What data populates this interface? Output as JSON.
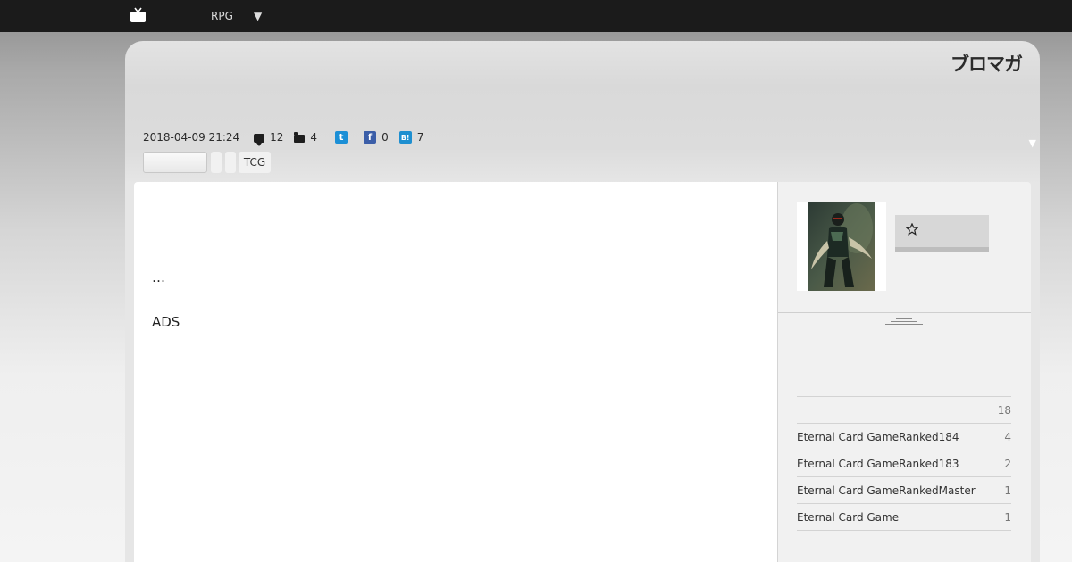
{
  "topbar": {
    "icon": "tv-icon",
    "menu_label": "RPG",
    "arrow": "▼"
  },
  "header": {
    "logo": "ブロマガ",
    "collapse_arrow": "▼"
  },
  "post": {
    "date": "2018-04-09 21:24",
    "comments": "12",
    "folders": "4",
    "twitter_glyph": "t",
    "facebook_glyph": "f",
    "facebook_count": "0",
    "hatena_glyph": "B!",
    "hatena_count": "7",
    "tags": [
      "",
      "",
      "",
      "TCG"
    ]
  },
  "article": {
    "ellipsis": "…",
    "ads": "ADS"
  },
  "sidebar": {
    "categories": [
      {
        "name": "",
        "count": "18"
      },
      {
        "name": "Eternal Card GameRanked184",
        "count": "4"
      },
      {
        "name": "Eternal Card GameRanked183",
        "count": "2"
      },
      {
        "name": "Eternal Card GameRankedMaster",
        "count": "1"
      },
      {
        "name": "Eternal Card Game",
        "count": "1"
      }
    ]
  },
  "colors": {
    "topbar": "#1b1b1b",
    "twitter": "#1b8fd6",
    "facebook": "#3b5ea8",
    "hatena": "#1e8fd0"
  }
}
